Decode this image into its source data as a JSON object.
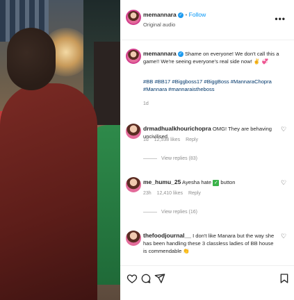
{
  "header": {
    "username": "memannara",
    "follow_label": "Follow",
    "audio_label": "Original audio",
    "more_label": "•••"
  },
  "caption": {
    "username": "memannara",
    "text": "Shame on everyone! We don't call this a game!! We're seeing everyone's real side now! ✌️ 💞",
    "hashtags": "#BB #BB17 #Biggboss17 #BiggBoss #MannaraChopra #Mannara #mannaraistheboss",
    "timestamp": "1d"
  },
  "comments": [
    {
      "username": "drmadhualkhourichopra",
      "text": "OMG! They are behaving uncivilised",
      "time": "1d",
      "likes": "12,538 likes",
      "reply_label": "Reply",
      "view_replies": "View replies (83)"
    },
    {
      "username": "me_humu_25",
      "text_before": "Ayesha hate",
      "text_after": "button",
      "time": "23h",
      "likes": "12,410 likes",
      "reply_label": "Reply",
      "view_replies": "View replies (16)"
    },
    {
      "username": "thefoodjournal__",
      "text": "I don't like Manara but the way she has been handling these 3 classless ladies of BB house is commendable 👏",
      "time": "",
      "likes": "",
      "reply_label": ""
    }
  ],
  "colors": {
    "accent": "#0095f6",
    "verified": "#1d9bf0",
    "story_ring": "#d33f8e",
    "hashtag": "#00376b",
    "secondary": "#8e8e8e"
  },
  "icons": [
    "heart-icon",
    "comment-icon",
    "share-icon",
    "bookmark-icon",
    "more-icon",
    "verified-icon"
  ]
}
